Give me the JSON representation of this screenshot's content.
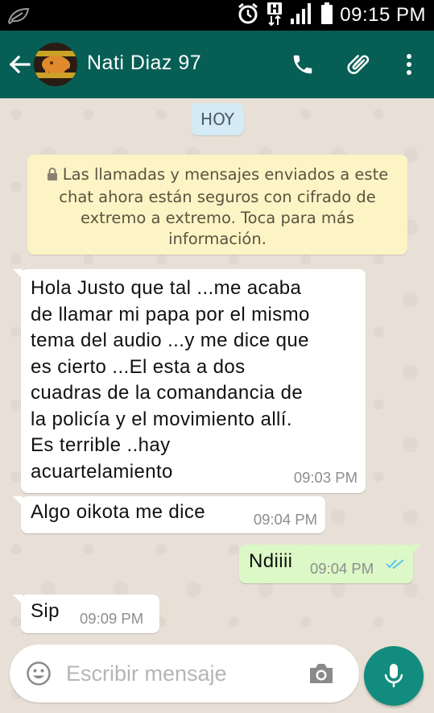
{
  "status_bar": {
    "time": "09:15 PM",
    "icons": [
      "leaf-icon",
      "alarm-icon",
      "data-h-icon",
      "signal-icon",
      "battery-icon"
    ]
  },
  "header": {
    "contact_name": "Nati Diaz 97",
    "icons": [
      "back-arrow-icon",
      "avatar",
      "phone-icon",
      "paperclip-icon",
      "more-vert-icon"
    ],
    "bg_color": "#075e54"
  },
  "chat": {
    "date_chip": "HOY",
    "encryption_notice": "Las llamadas y mensajes enviados a este chat ahora están seguros con cifrado de extremo a extremo. Toca para más información.",
    "messages": [
      {
        "direction": "incoming",
        "text": "Hola Justo que tal ...me acaba\nde llamar mi papa  por el mismo\ntema del audio ...y me dice que\nes cierto ...El esta a dos\ncuadras de la comandancia de\nla policía y el movimiento allí.\nEs terrible ..hay\nacuartelamiento",
        "time": "09:03 PM"
      },
      {
        "direction": "incoming",
        "text": "Algo oikota me dice",
        "time": "09:04 PM"
      },
      {
        "direction": "outgoing",
        "text": "Ndiiii",
        "time": "09:04 PM",
        "status": "read"
      },
      {
        "direction": "incoming",
        "text": "Sip",
        "time": "09:09 PM"
      }
    ]
  },
  "composer": {
    "placeholder": "Escribir mensaje",
    "value": "",
    "icons": [
      "emoji-icon",
      "camera-icon",
      "mic-icon"
    ]
  },
  "colors": {
    "outgoing_bubble": "#dcf8c6",
    "incoming_bubble": "#ffffff",
    "read_ticks": "#4fc3f7",
    "notice_bg": "#fdf4c5",
    "date_chip_bg": "#d4eaf4",
    "mic_button": "#128c7e"
  }
}
